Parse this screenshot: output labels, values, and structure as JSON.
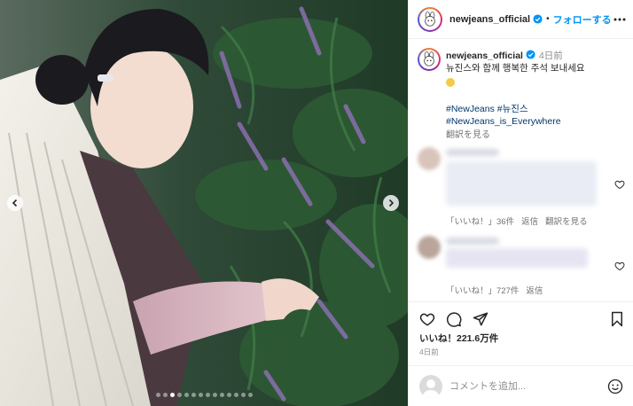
{
  "post": {
    "handle": "newjeans_official",
    "separator": "•",
    "follow_label": "フォローする"
  },
  "caption": {
    "handle": "newjeans_official",
    "time": "4日前",
    "text": "뉴진스와 함께 행복한 주석 보내세요",
    "hashtags_line1": "#NewJeans #뉴진스",
    "hashtags_line2": "#NewJeans_is_Everywhere",
    "translate_label": "翻訳を見る"
  },
  "comments": [
    {
      "likes_label": "「いいね！」36件",
      "reply_label": "返信",
      "translate_label": "翻訳を見る"
    },
    {
      "likes_label": "「いいね！」727件",
      "reply_label": "返信"
    }
  ],
  "stats": {
    "likes": "いいね！221.6万件",
    "age": "4日前"
  },
  "composer": {
    "placeholder": "コメントを追加..."
  },
  "carousel": {
    "slide_count": 14,
    "active_index": 2
  },
  "icons": {
    "prev": "chevron-left-icon",
    "next": "chevron-right-icon",
    "like": "heart-icon",
    "comment": "comment-icon",
    "share": "send-icon",
    "save": "bookmark-icon",
    "emoji": "smiley-icon",
    "more": "more-horizontal-icon",
    "verified": "verified-badge-icon"
  },
  "colors": {
    "link": "#0095f6",
    "hashtag": "#00376b",
    "verified": "#0095f6"
  }
}
